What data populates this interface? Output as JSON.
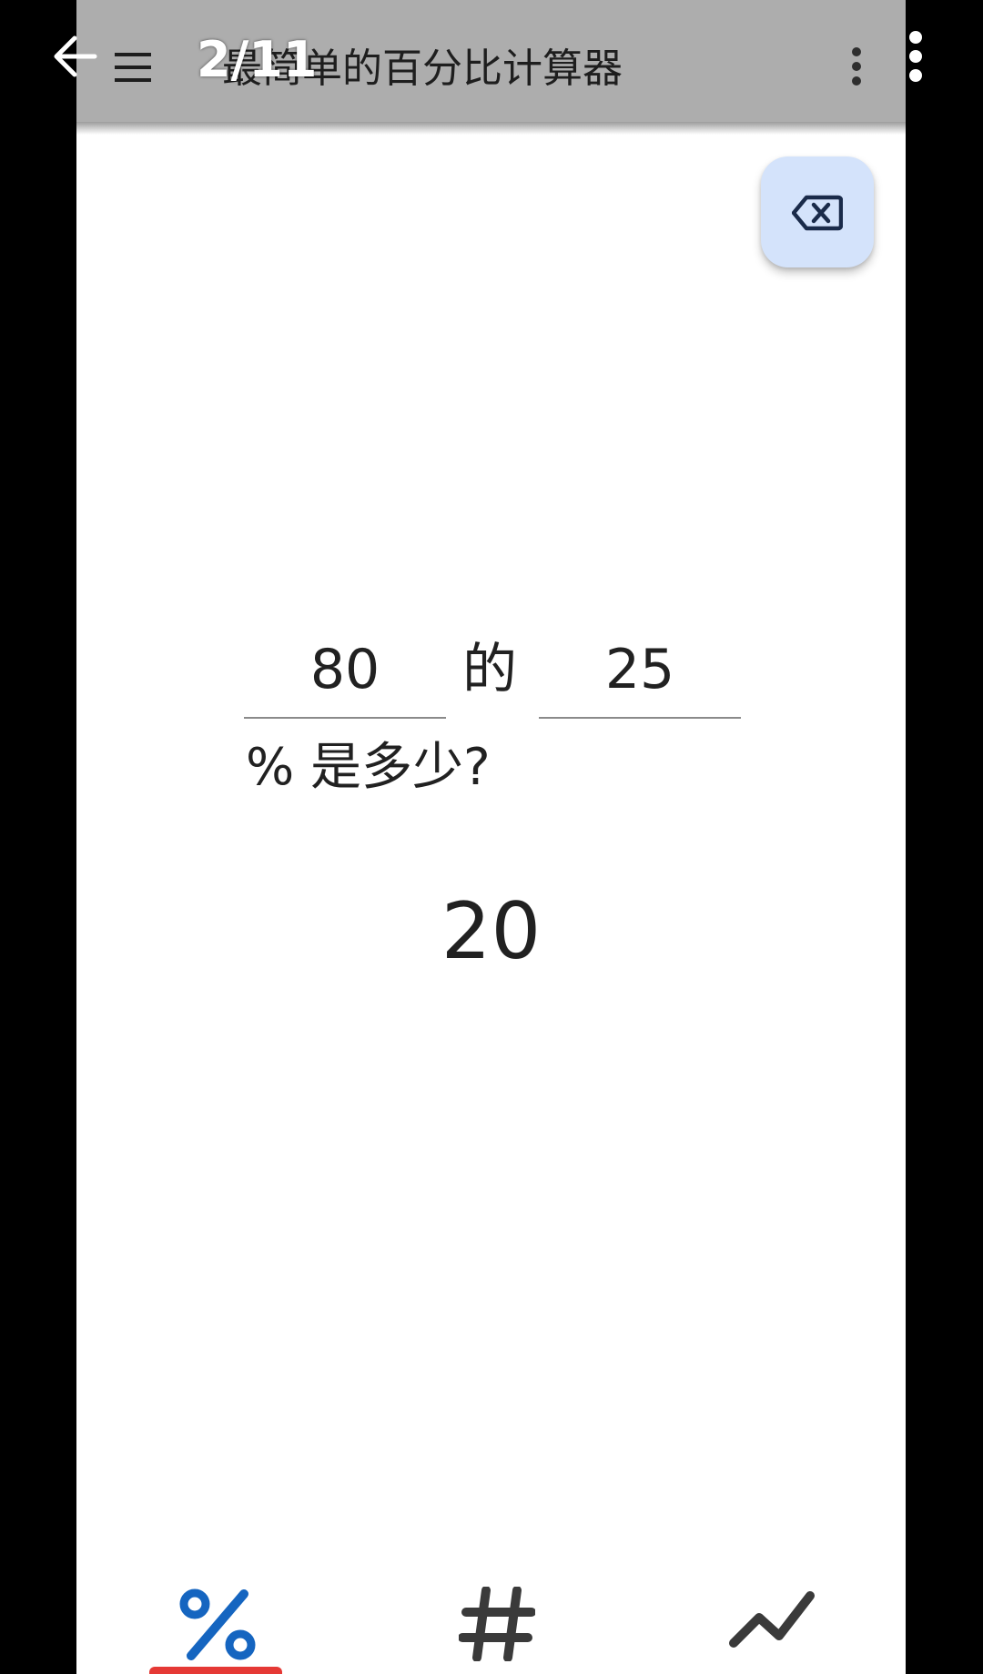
{
  "viewer": {
    "page_counter": "2/11",
    "back_icon": "arrow-left-icon",
    "more_icon": "more-vertical-icon"
  },
  "app_bar": {
    "title": "最简单的百分比计算器",
    "menu_icon": "hamburger-menu-icon",
    "more_icon": "more-vertical-icon",
    "background": "#adadad"
  },
  "fab": {
    "icon": "backspace-icon",
    "background": "#d4e3fb"
  },
  "calculator": {
    "first_value": "80",
    "of_label": "的",
    "second_value": "25",
    "question": "% 是多少?",
    "result": "20"
  },
  "bottom_nav": {
    "items": [
      {
        "icon": "percent-icon",
        "selected": true,
        "color": "#1565c0"
      },
      {
        "icon": "hash-icon",
        "selected": false,
        "color": "#3a3a3a"
      },
      {
        "icon": "trending-icon",
        "selected": false,
        "color": "#3a3a3a"
      }
    ],
    "indicator_color": "#e53935"
  }
}
